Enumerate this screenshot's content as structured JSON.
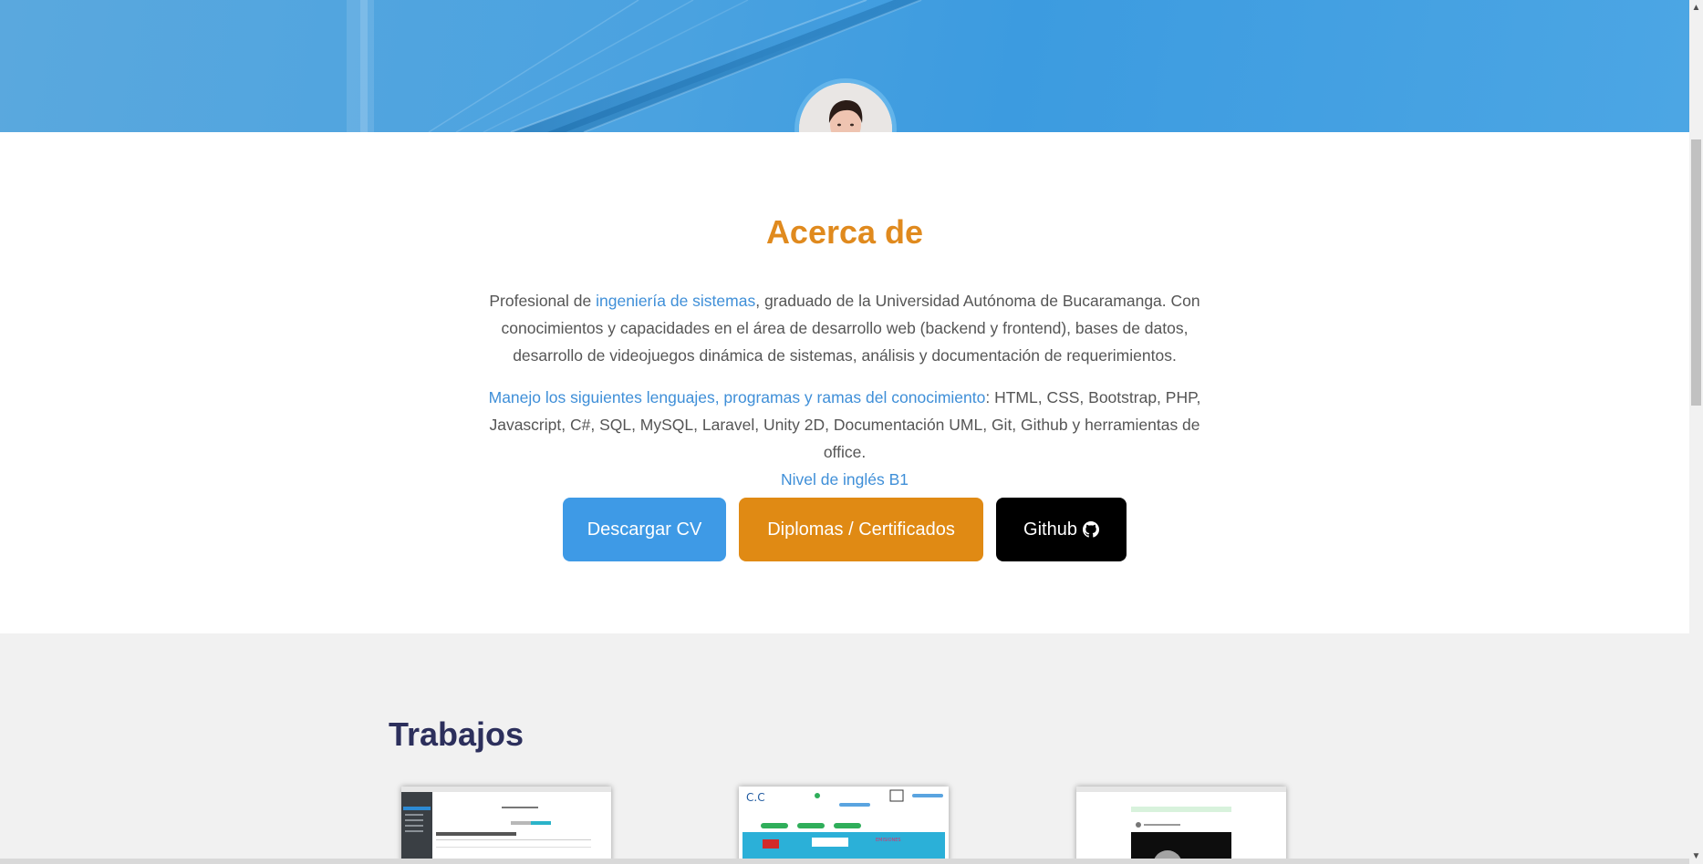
{
  "about": {
    "title": "Acerca de",
    "p1_prefix": "Profesional de ",
    "p1_highlight": "ingeniería de sistemas",
    "p1_suffix": ", graduado de la Universidad Autónoma de Bucaramanga. Con conocimientos y capacidades en el área de desarrollo web (backend y frontend), bases de datos, desarrollo de videojuegos dinámica de sistemas, análisis y documentación de requerimientos.",
    "p2_highlight": "Manejo los siguientes lenguajes, programas y ramas del conocimiento",
    "p2_suffix": ": HTML, CSS, Bootstrap, PHP, Javascript, C#, SQL, MySQL, Laravel, Unity 2D, Documentación UML, Git, Github y herramientas de office.",
    "p2_english": "Nivel de inglés B1"
  },
  "buttons": {
    "cv": "Descargar CV",
    "diplomas": "Diplomas / Certificados",
    "github": "Github"
  },
  "works": {
    "title": "Trabajos"
  },
  "colors": {
    "hero_blue": "#3d9ee0",
    "accent_orange": "#e08a1e",
    "link_blue": "#3f8fd8",
    "works_title": "#2c2f5c"
  },
  "icons": {
    "github": "github-icon"
  }
}
